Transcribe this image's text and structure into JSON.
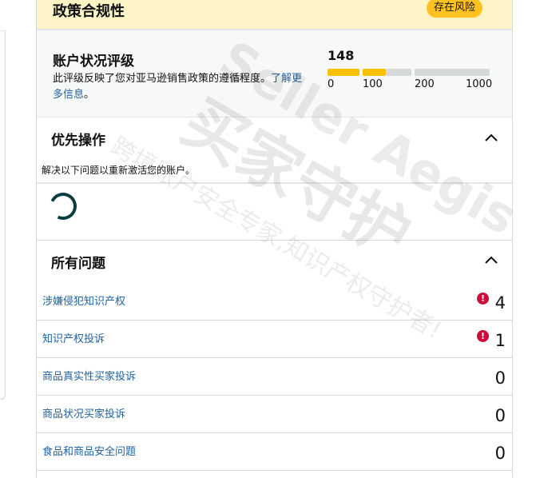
{
  "policy_header": {
    "title": "政策合规性",
    "risk_badge": "存在风险"
  },
  "account_health": {
    "title": "账户状况评级",
    "description": "此评级反映了您对亚马逊销售政策的遵循程度。",
    "learn_more": "了解更多信息",
    "description_end": "。",
    "score": "148",
    "scale_labels": [
      "0",
      "100",
      "200",
      "1000"
    ],
    "score_fraction": 0.148,
    "colors": {
      "filled": "#f9c100",
      "empty": "#d5d9d9"
    }
  },
  "priority_actions": {
    "title": "优先操作",
    "instruction": "解决以下问题以重新激活您的账户。"
  },
  "all_issues": {
    "title": "所有问题",
    "items": [
      {
        "label": "涉嫌侵犯知识产权",
        "count": "4",
        "alert": true
      },
      {
        "label": "知识产权投诉",
        "count": "1",
        "alert": true
      },
      {
        "label": "商品真实性买家投诉",
        "count": "0",
        "alert": false
      },
      {
        "label": "商品状况买家投诉",
        "count": "0",
        "alert": false
      },
      {
        "label": "食品和商品安全问题",
        "count": "0",
        "alert": false
      }
    ],
    "alert_symbol": "!"
  },
  "watermark": {
    "brand": "Seller Aegis",
    "chinese": "买家守护",
    "slogan": "跨境账户安全专家,知识产权守护者!"
  }
}
